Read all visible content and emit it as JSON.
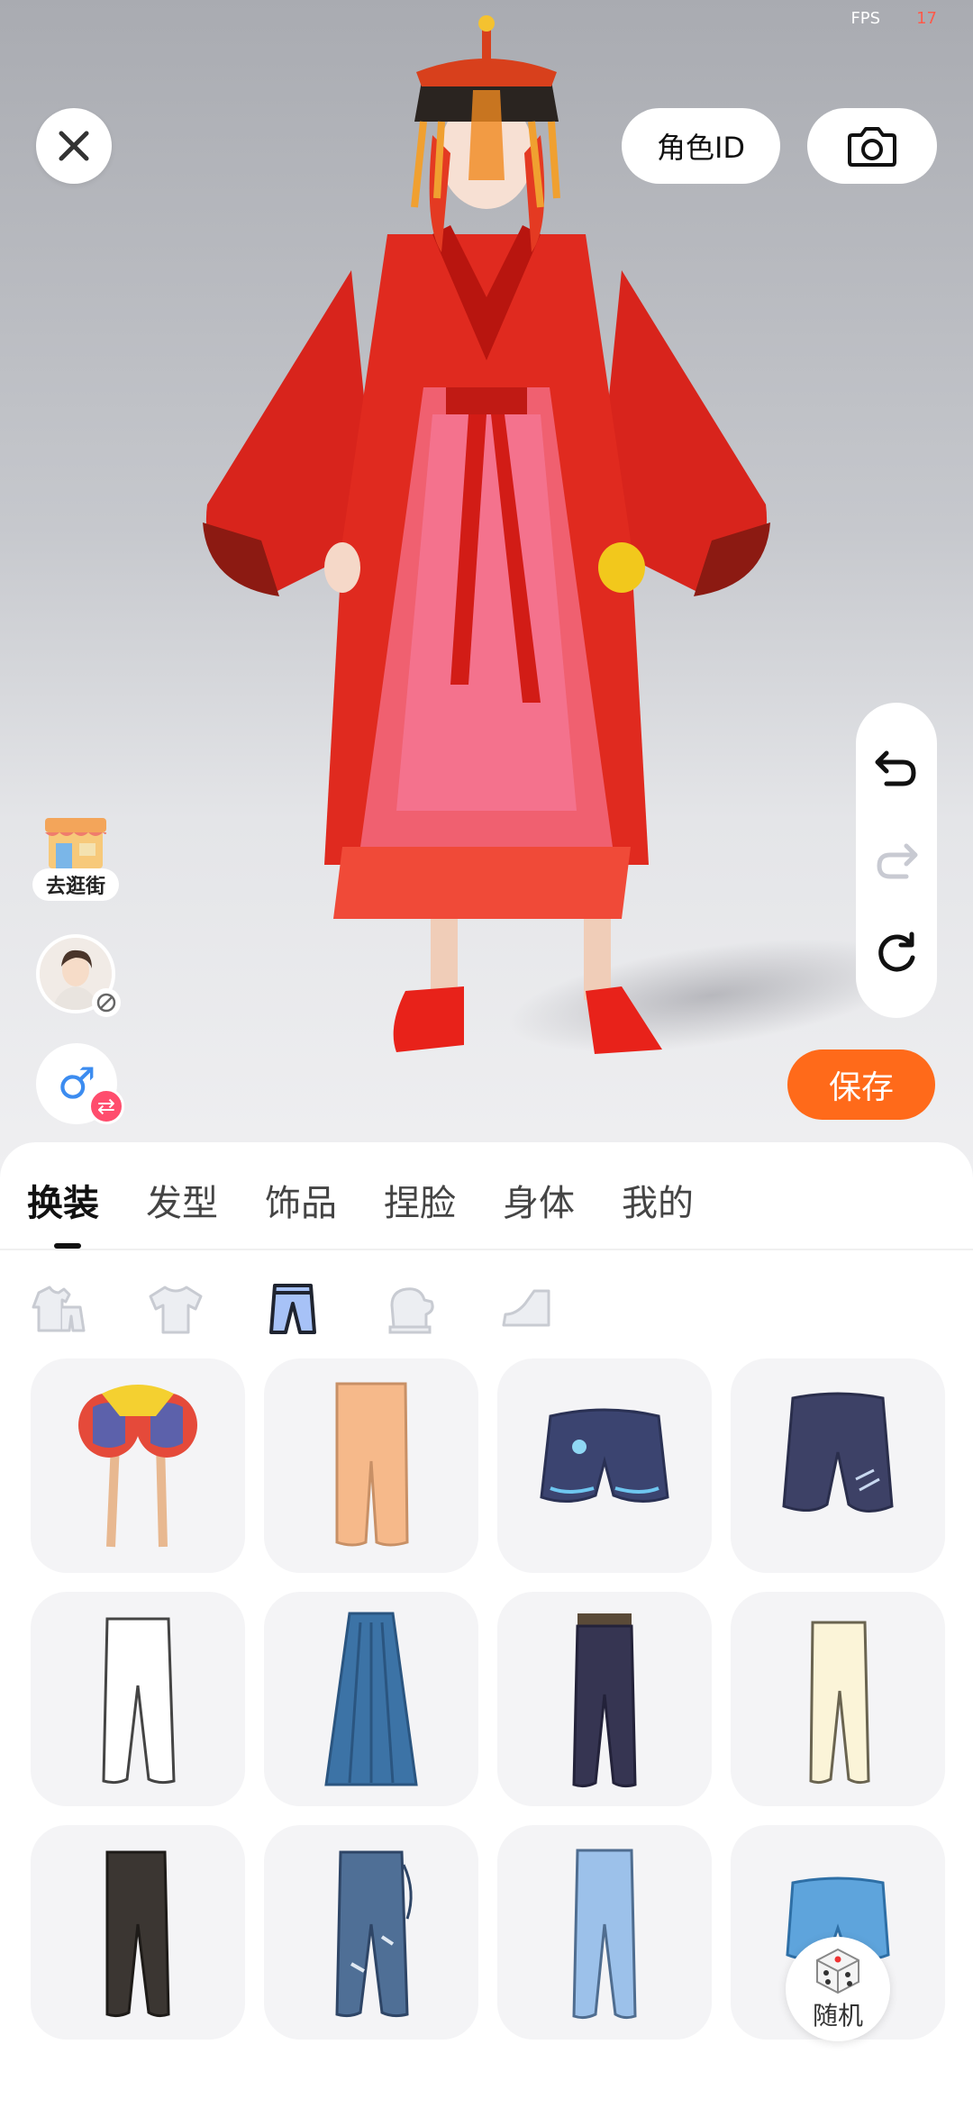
{
  "status": {
    "fps_label": "FPS",
    "fps_value": "17"
  },
  "top_bar": {
    "role_id_label": "角色ID"
  },
  "left_tools": {
    "street_label": "去逛街"
  },
  "save_label": "保存",
  "tabs": [
    {
      "label": "换装",
      "active": true
    },
    {
      "label": "发型",
      "active": false
    },
    {
      "label": "饰品",
      "active": false
    },
    {
      "label": "捏脸",
      "active": false
    },
    {
      "label": "身体",
      "active": false
    },
    {
      "label": "我的",
      "active": false
    }
  ],
  "subcategories": [
    {
      "icon": "outfit-set-icon",
      "active": false
    },
    {
      "icon": "top-icon",
      "active": false
    },
    {
      "icon": "pants-icon",
      "active": true
    },
    {
      "icon": "glove-icon",
      "active": false
    },
    {
      "icon": "shoe-icon",
      "active": false
    }
  ],
  "random_label": "随机",
  "colors": {
    "accent": "#ff6a1a",
    "gender": "#3c8cf0",
    "swap_badge": "#ff4d6d"
  }
}
